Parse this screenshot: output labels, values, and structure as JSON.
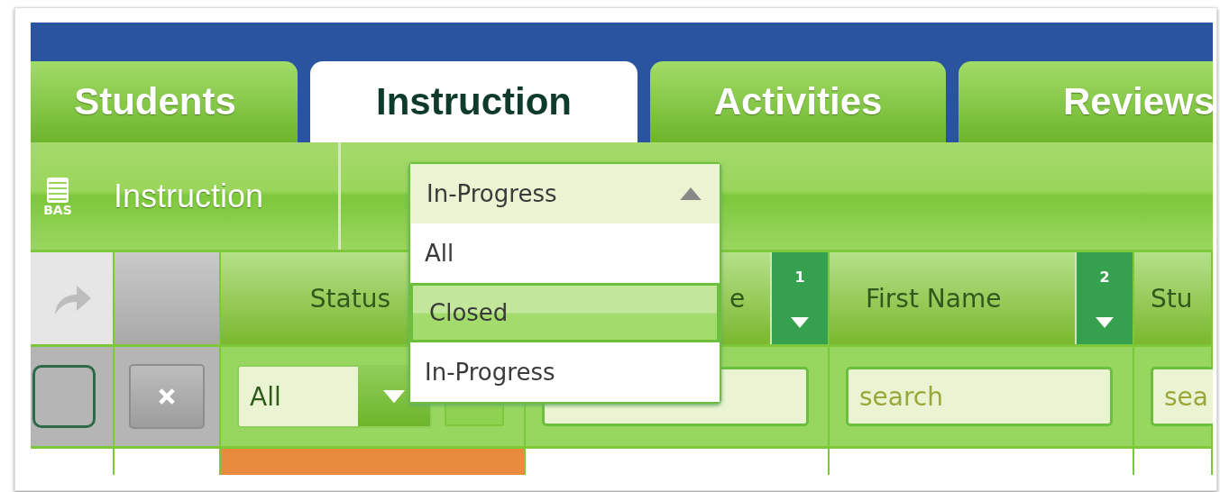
{
  "tabs": [
    {
      "label": "Students",
      "selected": false
    },
    {
      "label": "Instruction",
      "selected": true
    },
    {
      "label": "Activities",
      "selected": false
    },
    {
      "label": "Reviews",
      "selected": false
    }
  ],
  "toolbar": {
    "icon_label": "BAS",
    "title": "Instruction"
  },
  "status_dropdown": {
    "value": "In-Progress",
    "expanded": true,
    "options": [
      {
        "label": "All",
        "highlighted": false
      },
      {
        "label": "Closed",
        "highlighted": true
      },
      {
        "label": "In-Progress",
        "highlighted": false
      }
    ]
  },
  "table": {
    "select_all_checked": false,
    "columns": [
      {
        "kind": "status",
        "label": "Status",
        "filter_value": "All"
      },
      {
        "kind": "text",
        "label": "e",
        "sort_order": "1"
      },
      {
        "kind": "text",
        "label": "First Name",
        "sort_order": "2",
        "filter_placeholder": "search"
      },
      {
        "kind": "text",
        "label": "Stu",
        "filter_placeholder": "sea"
      }
    ],
    "rows": [
      {
        "color": "#e98b3f"
      }
    ]
  }
}
